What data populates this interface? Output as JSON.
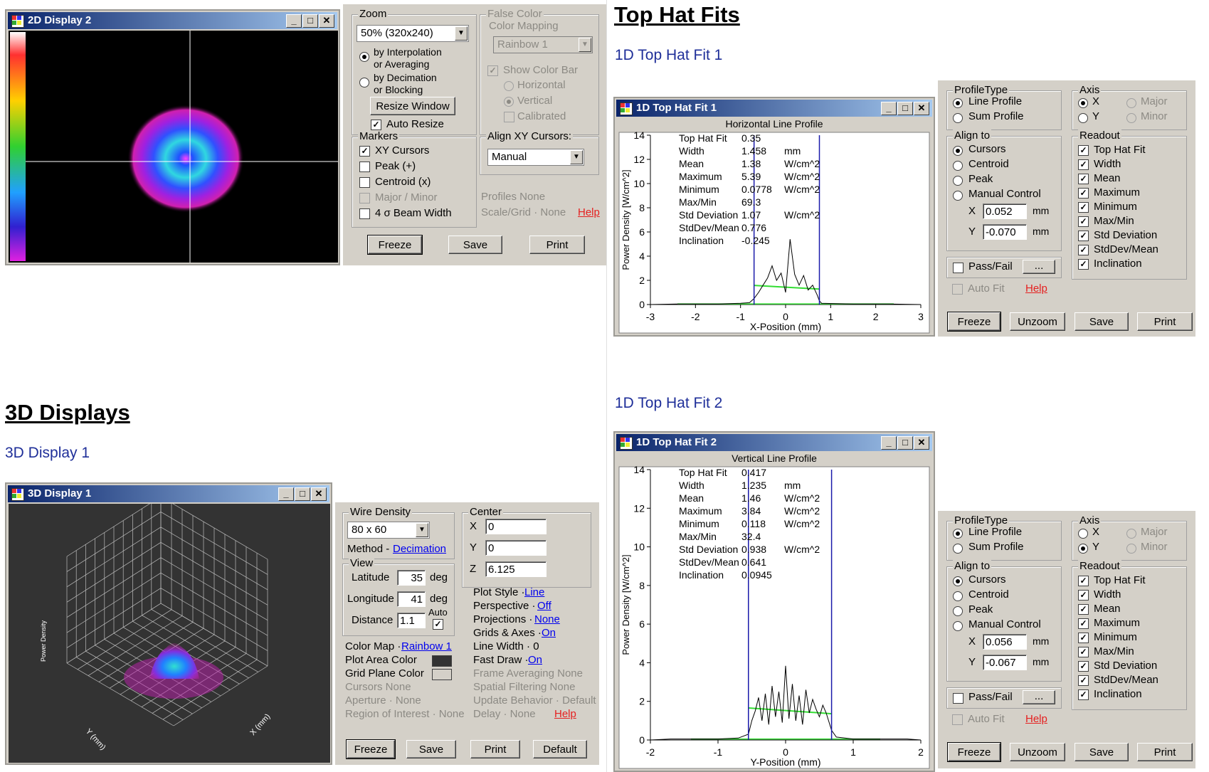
{
  "headings": {
    "top_hat_fits": "Top Hat Fits",
    "top_hat_fit_1_link": "1D Top Hat Fit 1",
    "top_hat_fit_2_link": "1D Top Hat Fit 2",
    "displays_3d": "3D Displays",
    "display_3d_1_link": "3D Display 1"
  },
  "display2d": {
    "title": "2D Display 2",
    "zoom_group": "Zoom",
    "zoom_value": "50%   (320x240)",
    "zoom_opt1": "by Interpolation",
    "zoom_opt1b": "or Averaging",
    "zoom_opt2": "by Decimation",
    "zoom_opt2b": "or Blocking",
    "resize_button": "Resize Window",
    "auto_resize": "Auto Resize",
    "false_color_group": "False Color",
    "color_mapping": "Color Mapping",
    "mapping_value": "Rainbow 1",
    "show_color_bar": "Show Color Bar",
    "horizontal": "Horizontal",
    "vertical": "Vertical",
    "calibrated": "Calibrated",
    "markers_group": "Markers",
    "xy_cursors": "XY Cursors",
    "peak": "Peak (+)",
    "centroid": "Centroid (x)",
    "major_minor": "Major / Minor",
    "beam_width": "4 σ  Beam Width",
    "align_group": "Align XY Cursors:",
    "align_value": "Manual",
    "profiles": "Profiles  None",
    "scale_grid": "Scale/Grid · None",
    "help": "Help",
    "freeze": "Freeze",
    "save": "Save",
    "print": "Print"
  },
  "fit1": {
    "title": "1D Top Hat Fit 1",
    "plot_title": "Horizontal Line Profile",
    "ylabel": "Power Density [W/cm^2]",
    "xlabel": "X-Position (mm)",
    "yticks": [
      "14",
      "12",
      "10",
      "8",
      "6",
      "4",
      "2",
      "0"
    ],
    "xticks": [
      "-3",
      "-2",
      "-1",
      "0",
      "1",
      "2",
      "3"
    ],
    "stats": [
      {
        "name": "Top Hat Fit",
        "value": "0.35",
        "unit": ""
      },
      {
        "name": "Width",
        "value": "1.458",
        "unit": "mm"
      },
      {
        "name": "Mean",
        "value": "1.38",
        "unit": "W/cm^2"
      },
      {
        "name": "Maximum",
        "value": "5.39",
        "unit": "W/cm^2"
      },
      {
        "name": "Minimum",
        "value": "0.0778",
        "unit": "W/cm^2"
      },
      {
        "name": "Max/Min",
        "value": "69.3",
        "unit": ""
      },
      {
        "name": "Std Deviation",
        "value": "1.07",
        "unit": "W/cm^2"
      },
      {
        "name": "StdDev/Mean",
        "value": "0.776",
        "unit": ""
      },
      {
        "name": "Inclination",
        "value": "-0.245",
        "unit": ""
      }
    ],
    "profile_type": "ProfileType",
    "line_profile": "Line Profile",
    "sum_profile": "Sum Profile",
    "axis": "Axis",
    "axis_x": "X",
    "axis_y": "Y",
    "major": "Major",
    "minor": "Minor",
    "align_to": "Align to",
    "cursors": "Cursors",
    "centroid": "Centroid",
    "peak": "Peak",
    "manual_control": "Manual Control",
    "x_label": "X",
    "y_label": "Y",
    "x_value": "0.052",
    "y_value": "-0.070",
    "mm": "mm",
    "pass_fail": "Pass/Fail",
    "ellipsis": "...",
    "auto_fit": "Auto Fit",
    "help": "Help",
    "readout": "Readout",
    "readout_items": [
      "Top Hat Fit",
      "Width",
      "Mean",
      "Maximum",
      "Minimum",
      "Max/Min",
      "Std Deviation",
      "StdDev/Mean",
      "Inclination"
    ],
    "freeze": "Freeze",
    "unzoom": "Unzoom",
    "save": "Save",
    "print": "Print"
  },
  "fit2": {
    "title": "1D Top Hat Fit 2",
    "plot_title": "Vertical Line Profile",
    "ylabel": "Power Density [W/cm^2]",
    "xlabel": "Y-Position (mm)",
    "yticks": [
      "14",
      "12",
      "10",
      "8",
      "6",
      "4",
      "2",
      "0"
    ],
    "xticks": [
      "-2",
      "-1",
      "0",
      "1",
      "2"
    ],
    "stats": [
      {
        "name": "Top Hat Fit",
        "value": "0.417",
        "unit": ""
      },
      {
        "name": "Width",
        "value": "1.235",
        "unit": "mm"
      },
      {
        "name": "Mean",
        "value": "1.46",
        "unit": "W/cm^2"
      },
      {
        "name": "Maximum",
        "value": "3.84",
        "unit": "W/cm^2"
      },
      {
        "name": "Minimum",
        "value": "0.118",
        "unit": "W/cm^2"
      },
      {
        "name": "Max/Min",
        "value": "32.4",
        "unit": ""
      },
      {
        "name": "Std Deviation",
        "value": "0.938",
        "unit": "W/cm^2"
      },
      {
        "name": "StdDev/Mean",
        "value": "0.641",
        "unit": ""
      },
      {
        "name": "Inclination",
        "value": "0.0945",
        "unit": ""
      }
    ],
    "profile_type": "ProfileType",
    "line_profile": "Line Profile",
    "sum_profile": "Sum Profile",
    "axis": "Axis",
    "axis_x": "X",
    "axis_y": "Y",
    "major": "Major",
    "minor": "Minor",
    "align_to": "Align to",
    "cursors": "Cursors",
    "centroid": "Centroid",
    "peak": "Peak",
    "manual_control": "Manual Control",
    "x_label": "X",
    "y_label": "Y",
    "x_value": "0.056",
    "y_value": "-0.067",
    "mm": "mm",
    "pass_fail": "Pass/Fail",
    "ellipsis": "...",
    "auto_fit": "Auto Fit",
    "help": "Help",
    "readout": "Readout",
    "readout_items": [
      "Top Hat Fit",
      "Width",
      "Mean",
      "Maximum",
      "Minimum",
      "Max/Min",
      "Std Deviation",
      "StdDev/Mean",
      "Inclination"
    ],
    "freeze": "Freeze",
    "unzoom": "Unzoom",
    "save": "Save",
    "print": "Print"
  },
  "display3d": {
    "title": "3D Display 1",
    "axis_x_label": "X (mm)",
    "axis_y_label": "Y (mm)",
    "axis_z_label": "Power Density",
    "wire_density": "Wire Density",
    "wire_value": "80 x 60",
    "method": "Method -",
    "method_value": "Decimation",
    "view": "View",
    "latitude": "Latitude",
    "latitude_value": "35",
    "longitude": "Longitude",
    "longitude_value": "41",
    "distance": "Distance",
    "distance_value": "1.1",
    "deg": "deg",
    "auto": "Auto",
    "center": "Center",
    "cx": "X",
    "cy": "Y",
    "cz": "Z",
    "cx_value": "0",
    "cy_value": "0",
    "cz_value": "6.125",
    "color_map": "Color Map ·",
    "color_map_value": "Rainbow 1",
    "plot_area_color": "Plot Area Color",
    "grid_plane_color": "Grid Plane Color",
    "cursors": "Cursors  None",
    "aperture": "Aperture · None",
    "roi": "Region of Interest · None",
    "plot_style": "Plot Style ·",
    "plot_style_value": "Line",
    "perspective": "Perspective ·",
    "perspective_value": "Off",
    "projections": "Projections ·",
    "projections_value": "None",
    "grids_axes": "Grids & Axes ·",
    "grids_axes_value": "On",
    "line_width": "Line Width · 0",
    "fast_draw": "Fast Draw ·",
    "fast_draw_value": "On",
    "frame_avg": "Frame Averaging  None",
    "spatial_filter": "Spatial Filtering  None",
    "update_behavior": "Update Behavior · Default",
    "delay": "Delay · None",
    "help": "Help",
    "freeze": "Freeze",
    "save": "Save",
    "print": "Print",
    "default": "Default"
  },
  "colors": {
    "plot_area": "#333333",
    "grid_plane": "#d4d0c8",
    "fit_line": "#33dd33",
    "cursor_line": "#1a1aaa",
    "heading_link": "#1f2f99"
  },
  "chart_data": [
    {
      "type": "line",
      "title": "Horizontal Line Profile",
      "xlabel": "X-Position (mm)",
      "ylabel": "Power Density [W/cm^2]",
      "xlim": [
        -3,
        3
      ],
      "ylim": [
        0,
        14
      ],
      "cursors_x": [
        -0.7,
        0.75
      ],
      "fit_level": 1.38,
      "profile": {
        "x": [
          -3,
          -2.4,
          -1.5,
          -1.0,
          -0.8,
          -0.7,
          -0.6,
          -0.5,
          -0.4,
          -0.3,
          -0.2,
          -0.1,
          0,
          0.1,
          0.2,
          0.3,
          0.4,
          0.5,
          0.6,
          0.7,
          0.75,
          0.8,
          1.5,
          2.3,
          3
        ],
        "y": [
          0,
          0.05,
          0.05,
          0.1,
          0.15,
          0.5,
          1.0,
          1.6,
          2.2,
          3.2,
          2.0,
          2.6,
          1.0,
          5.4,
          2.5,
          1.6,
          2.4,
          1.2,
          1.6,
          0.8,
          0.3,
          0.1,
          0.05,
          0.05,
          0
        ]
      }
    },
    {
      "type": "line",
      "title": "Vertical Line Profile",
      "xlabel": "Y-Position (mm)",
      "ylabel": "Power Density [W/cm^2]",
      "xlim": [
        -2,
        2
      ],
      "ylim": [
        0,
        14
      ],
      "cursors_x": [
        -0.55,
        0.68
      ],
      "fit_level": 1.46,
      "profile": {
        "x": [
          -2,
          -1.7,
          -1.0,
          -0.7,
          -0.55,
          -0.5,
          -0.45,
          -0.4,
          -0.35,
          -0.3,
          -0.25,
          -0.2,
          -0.15,
          -0.1,
          -0.05,
          0,
          0.05,
          0.1,
          0.15,
          0.2,
          0.25,
          0.3,
          0.35,
          0.4,
          0.45,
          0.5,
          0.55,
          0.6,
          0.68,
          0.75,
          1.0,
          1.8,
          2
        ],
        "y": [
          0,
          0.05,
          0.05,
          0.1,
          0.3,
          1.0,
          1.5,
          2.2,
          1.0,
          2.4,
          0.8,
          2.8,
          1.2,
          2.5,
          0.9,
          3.84,
          1.1,
          2.9,
          1.0,
          2.3,
          0.8,
          2.6,
          1.4,
          2.1,
          1.6,
          1.2,
          1.8,
          1.4,
          0.5,
          0.15,
          0.05,
          0.05,
          0
        ]
      }
    }
  ]
}
